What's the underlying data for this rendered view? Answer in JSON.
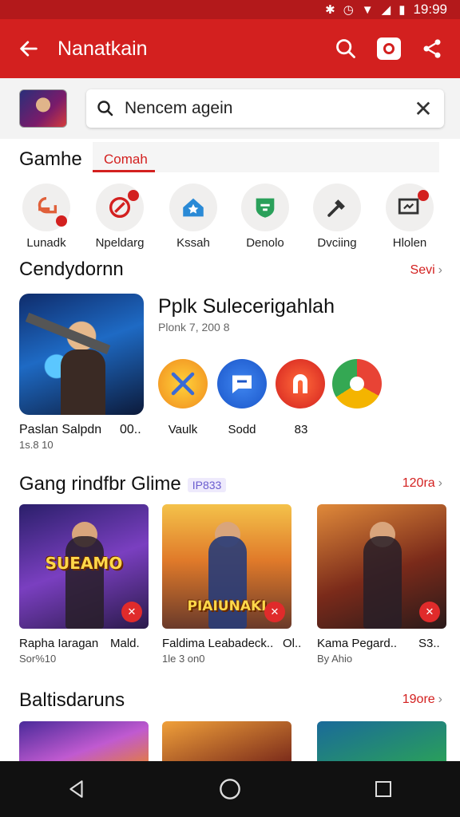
{
  "status": {
    "time": "19:99"
  },
  "app_bar": {
    "title": "Nanatkain"
  },
  "search": {
    "query": "Nencem agein"
  },
  "tabs": {
    "main": "Gamhe",
    "active": "Comah"
  },
  "categories": [
    {
      "label": "Lunadk",
      "icon": "gamepad-icon"
    },
    {
      "label": "Npeldarg",
      "icon": "compass-icon"
    },
    {
      "label": "Kssah",
      "icon": "home-star-icon"
    },
    {
      "label": "Denolo",
      "icon": "shield-icon"
    },
    {
      "label": "Dvciing",
      "icon": "hammer-icon"
    },
    {
      "label": "Hlolen",
      "icon": "screen-icon"
    }
  ],
  "section1": {
    "title": "Cendydornn",
    "see_more": "Sevi",
    "featured": {
      "name": "Paslan Salpdn",
      "meta": "00..",
      "sub": "1s.8 10"
    },
    "headline": "Pplk Sulecerigahlah",
    "headline_sub": "Plonk 7, 200 8",
    "apps": [
      {
        "label": "Vaulk",
        "icon": "crossed-swords-icon"
      },
      {
        "label": "Sodd",
        "icon": "chat-icon"
      },
      {
        "label": "83",
        "icon": "arch-icon"
      },
      {
        "label": "",
        "icon": "chrome-icon"
      }
    ]
  },
  "section2": {
    "title": "Gang rindfbr Glime",
    "badge": "IP833",
    "see_more": "120ra",
    "cards": [
      {
        "name": "Rapha Iaragan",
        "rating": "Mald.",
        "sub": "Sor%10",
        "banner": "SUEAMO"
      },
      {
        "name": "Faldima Leabadeck..",
        "rating": "Ol..",
        "sub": "1le 3 on0",
        "banner": "PIAIUNAKI"
      },
      {
        "name": "Kama Pegard..",
        "rating": "S3..",
        "sub": "By Ahio",
        "banner": ""
      }
    ]
  },
  "section3": {
    "title": "Baltisdaruns",
    "see_more": "19ore"
  },
  "colors": {
    "primary": "#d3201f",
    "status_bar": "#b3191b",
    "accent_purple": "#6a5ccf"
  }
}
